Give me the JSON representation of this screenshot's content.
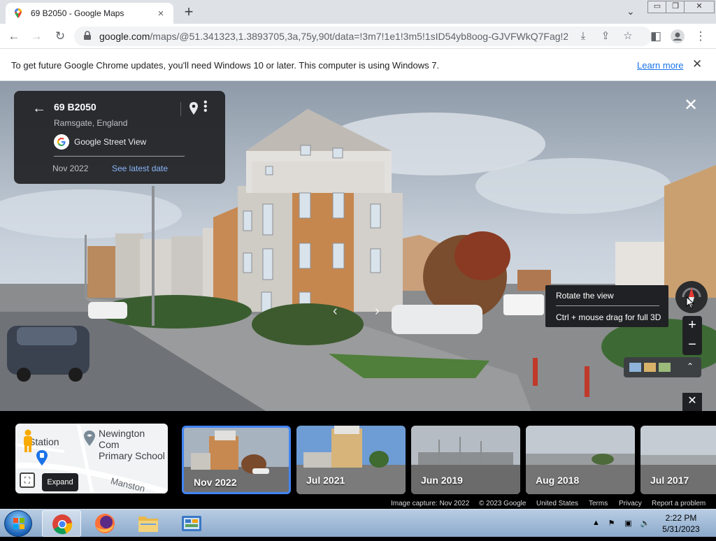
{
  "browser": {
    "tab_title": "69 B2050 - Google Maps",
    "tab_close": "×",
    "new_tab": "+",
    "url_host": "google.com",
    "url_path": "/maps/@51.341323,1.3893705,3a,75y,90t/data=!3m7!1e1!3m5!1sID54yb8oog-GJVFWkQ7Fag!2...",
    "window_controls": [
      "▭",
      "❐",
      "✕"
    ]
  },
  "infobar": {
    "message": "To get future Google Chrome updates, you'll need Windows 10 or later. This computer is using Windows 7.",
    "link": "Learn more",
    "close": "✕"
  },
  "location_card": {
    "title": "69 B2050",
    "subtitle": "Ramsgate, England",
    "source": "Google Street View",
    "date": "Nov 2022",
    "latest_link": "See latest date"
  },
  "viewer": {
    "close": "✕",
    "tooltip_title": "Rotate the view",
    "tooltip_hint": "Ctrl + mouse drag for full 3D",
    "zoom_in": "+",
    "zoom_out": "−",
    "film_close": "✕",
    "layer_expand": "⌃"
  },
  "minimap": {
    "place_label": "Station",
    "school_line1": "Newington Com",
    "school_line2": "Primary School",
    "road_label": "Manston",
    "expand_tooltip": "Expand"
  },
  "thumbnails": [
    {
      "label": "Nov 2022",
      "selected": true
    },
    {
      "label": "Jul 2021",
      "selected": false
    },
    {
      "label": "Jun 2019",
      "selected": false
    },
    {
      "label": "Aug 2018",
      "selected": false
    },
    {
      "label": "Jul 2017",
      "selected": false
    }
  ],
  "footer": {
    "capture": "Image capture: Nov 2022",
    "copyright": "© 2023 Google",
    "region": "United States",
    "terms": "Terms",
    "privacy": "Privacy",
    "report": "Report a problem"
  },
  "taskbar": {
    "time": "2:22 PM",
    "date": "5/31/2023"
  },
  "colors": {
    "accent_blue": "#4285f4",
    "link_blue": "#1a73e8",
    "card_bg": "#202124"
  }
}
